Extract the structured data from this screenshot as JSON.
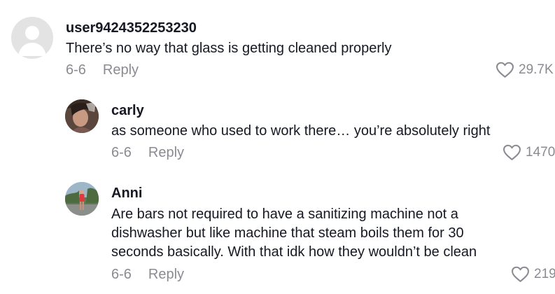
{
  "comments": [
    {
      "username": "user9424352253230",
      "text": [
        "There’s no way that glass is getting cleaned properly"
      ],
      "date": "6-6",
      "reply_label": "Reply",
      "likes": "29.7K",
      "avatar": "default-avatar-icon"
    },
    {
      "username": "carly",
      "text": [
        "as someone who used to work there… you’re absolutely right"
      ],
      "date": "6-6",
      "reply_label": "Reply",
      "likes": "1470",
      "avatar": "photo-avatar"
    },
    {
      "username": "Anni",
      "text": [
        "Are bars not required to have a sanitizing machine not a",
        "dishwasher but like machine that steam boils them for 30",
        "seconds basically. With that idk how they wouldn’t be clean"
      ],
      "date": "6-6",
      "reply_label": "Reply",
      "likes": "219",
      "avatar": "photo-avatar"
    }
  ],
  "colors": {
    "text": "#161823",
    "meta": "#8a8b91",
    "avatar_default_bg": "#e3e3e4"
  }
}
